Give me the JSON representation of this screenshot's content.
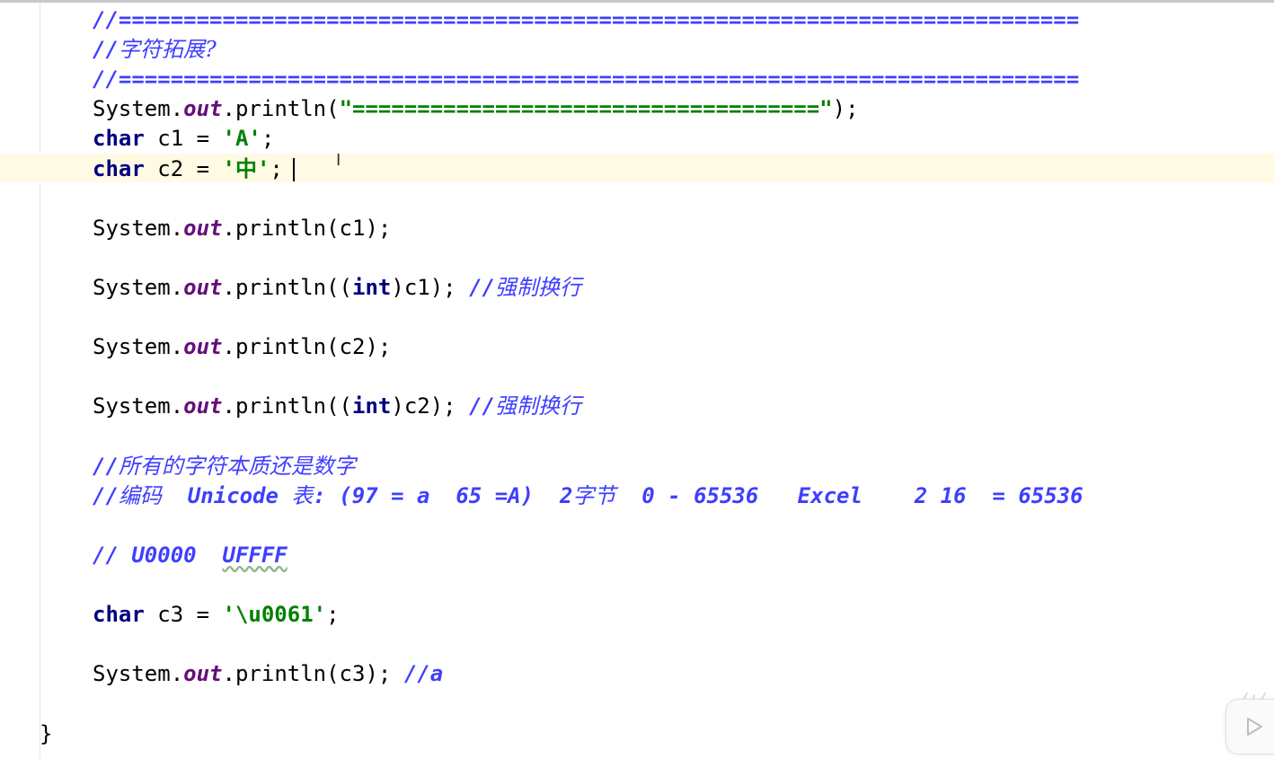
{
  "editor": {
    "lines": [
      {
        "parts": [
          {
            "t": "//==========================================================================",
            "c": "cmt"
          }
        ]
      },
      {
        "parts": [
          {
            "t": "//",
            "c": "cmt"
          },
          {
            "t": "字符拓展?",
            "c": "cmt-cn"
          }
        ]
      },
      {
        "parts": [
          {
            "t": "//==========================================================================",
            "c": "cmt"
          }
        ]
      },
      {
        "parts": [
          {
            "t": "System.",
            "c": ""
          },
          {
            "t": "out",
            "c": "fld"
          },
          {
            "t": ".println(",
            "c": ""
          },
          {
            "t": "\"====================================\"",
            "c": "str"
          },
          {
            "t": ");",
            "c": ""
          }
        ]
      },
      {
        "parts": [
          {
            "t": "char",
            "c": "kw"
          },
          {
            "t": " c1 = ",
            "c": ""
          },
          {
            "t": "'A'",
            "c": "str"
          },
          {
            "t": ";",
            "c": ""
          }
        ]
      },
      {
        "parts": [
          {
            "t": "char",
            "c": "kw"
          },
          {
            "t": " c2 = ",
            "c": ""
          },
          {
            "t": "'中'",
            "c": "str"
          },
          {
            "t": ";",
            "c": ""
          }
        ]
      },
      {
        "parts": []
      },
      {
        "parts": [
          {
            "t": "System.",
            "c": ""
          },
          {
            "t": "out",
            "c": "fld"
          },
          {
            "t": ".println(c1);",
            "c": ""
          }
        ]
      },
      {
        "parts": []
      },
      {
        "parts": [
          {
            "t": "System.",
            "c": ""
          },
          {
            "t": "out",
            "c": "fld"
          },
          {
            "t": ".println((",
            "c": ""
          },
          {
            "t": "int",
            "c": "kw"
          },
          {
            "t": ")c1); ",
            "c": ""
          },
          {
            "t": "//",
            "c": "cmt"
          },
          {
            "t": "强制换行",
            "c": "cmt-cn"
          }
        ]
      },
      {
        "parts": []
      },
      {
        "parts": [
          {
            "t": "System.",
            "c": ""
          },
          {
            "t": "out",
            "c": "fld"
          },
          {
            "t": ".println(c2);",
            "c": ""
          }
        ]
      },
      {
        "parts": []
      },
      {
        "parts": [
          {
            "t": "System.",
            "c": ""
          },
          {
            "t": "out",
            "c": "fld"
          },
          {
            "t": ".println((",
            "c": ""
          },
          {
            "t": "int",
            "c": "kw"
          },
          {
            "t": ")c2); ",
            "c": ""
          },
          {
            "t": "//",
            "c": "cmt"
          },
          {
            "t": "强制换行",
            "c": "cmt-cn"
          }
        ]
      },
      {
        "parts": []
      },
      {
        "parts": [
          {
            "t": "//",
            "c": "cmt"
          },
          {
            "t": "所有的字符本质还是数字",
            "c": "cmt-cn"
          }
        ]
      },
      {
        "parts": [
          {
            "t": "//",
            "c": "cmt"
          },
          {
            "t": "编码",
            "c": "cmt-cn"
          },
          {
            "t": "  Unicode ",
            "c": "cmt"
          },
          {
            "t": "表",
            "c": "cmt-cn"
          },
          {
            "t": ": (97 = a  65 =A)  2",
            "c": "cmt"
          },
          {
            "t": "字节",
            "c": "cmt-cn"
          },
          {
            "t": "  0 - 65536   Excel    2 16  = 65536",
            "c": "cmt"
          }
        ]
      },
      {
        "parts": []
      },
      {
        "parts": [
          {
            "t": "// U0000  ",
            "c": "cmt"
          },
          {
            "t": "UFFFF",
            "c": "cmt typo"
          }
        ]
      },
      {
        "parts": []
      },
      {
        "parts": [
          {
            "t": "char",
            "c": "kw"
          },
          {
            "t": " c3 = ",
            "c": ""
          },
          {
            "t": "'\\u0061'",
            "c": "str"
          },
          {
            "t": ";",
            "c": ""
          }
        ]
      },
      {
        "parts": []
      },
      {
        "parts": [
          {
            "t": "System.",
            "c": ""
          },
          {
            "t": "out",
            "c": "fld"
          },
          {
            "t": ".println(c3); ",
            "c": ""
          },
          {
            "t": "//a",
            "c": "cmt"
          }
        ]
      }
    ],
    "closing_brace": "}",
    "ibeam_glyph": "I"
  },
  "colors": {
    "keyword": "#000080",
    "field": "#660e7a",
    "string": "#008000",
    "comment": "#3f3fff",
    "caret_row": "#fffae3"
  },
  "icons": {
    "play": "play-icon"
  }
}
